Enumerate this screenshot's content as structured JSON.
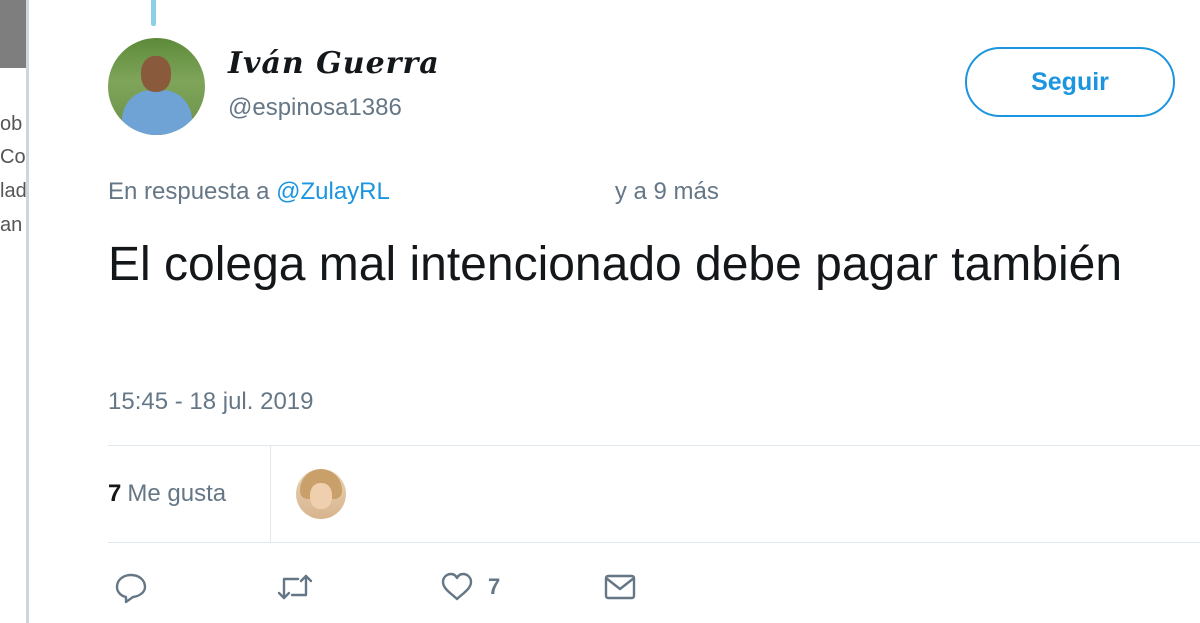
{
  "background_fragments": [
    "ob",
    "Co",
    "lad",
    "an"
  ],
  "tweet": {
    "author_name": "Iván Guerra",
    "author_handle": "@espinosa1386",
    "follow_label": "Seguir",
    "reply_prefix": "En respuesta a ",
    "reply_mention": "@ZulayRL",
    "reply_suffix": "y a 9 más",
    "text": "El colega mal intencionado debe pagar también",
    "timestamp": "15:45 - 18 jul. 2019",
    "likes_count": "7",
    "likes_label": "Me gusta"
  },
  "actions": {
    "reply_icon": "reply-icon",
    "retweet_icon": "retweet-icon",
    "like_icon": "heart-icon",
    "like_count": "7",
    "dm_icon": "envelope-icon"
  },
  "colors": {
    "accent": "#1b95e0",
    "secondary_text": "#657786",
    "primary_text": "#14171a"
  }
}
